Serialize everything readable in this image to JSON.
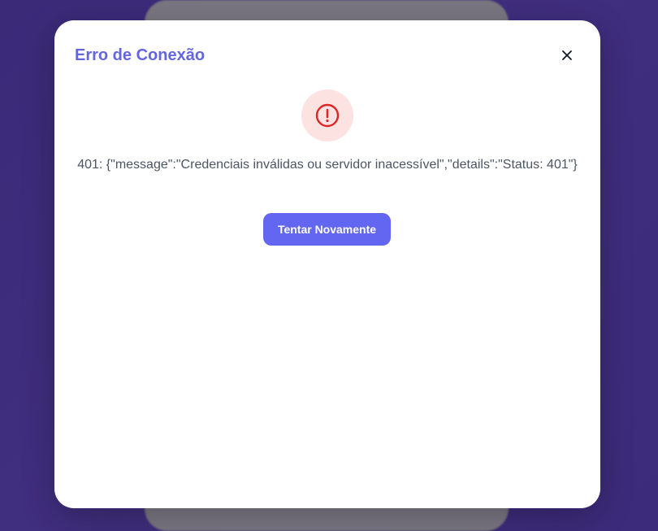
{
  "modal": {
    "title": "Erro de Conexão",
    "message": "401: {\"message\":\"Credenciais inválidas ou servidor inacessível\",\"details\":\"Status: 401\"}",
    "retry_label": "Tentar Novamente",
    "close_icon": "close-icon",
    "status_icon": "alert-circle-icon"
  },
  "colors": {
    "backdrop": "#3f2f7c",
    "title": "#6366e0",
    "button": "#6366f1",
    "icon_bg": "#fde2e2",
    "icon": "#dc2626",
    "message": "#4b5563"
  }
}
